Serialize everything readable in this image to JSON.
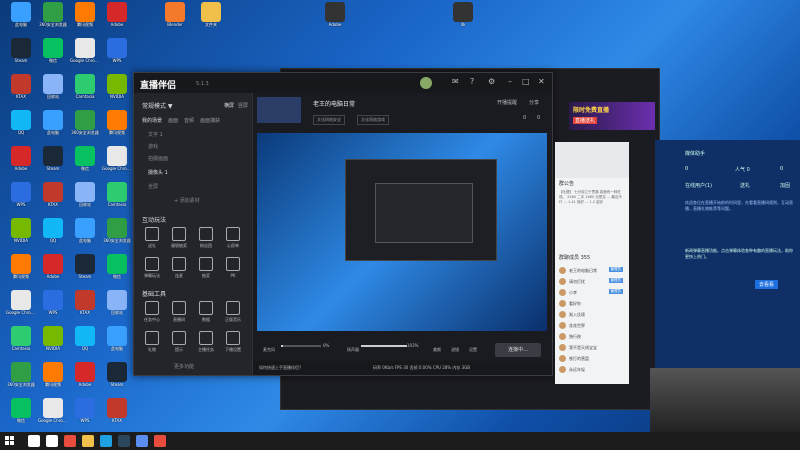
{
  "desktop": {
    "icons": [
      {
        "label": "此电脑",
        "color": "#3aa0ff"
      },
      {
        "label": "360安全浏览器",
        "color": "#2f9e44"
      },
      {
        "label": "腾讯视频",
        "color": "#ff7a00"
      },
      {
        "label": "Adobe",
        "color": "#d62828"
      },
      {
        "label": "Steam",
        "color": "#1b2838"
      },
      {
        "label": "微信",
        "color": "#07c160"
      },
      {
        "label": "Google Chrome",
        "color": "#e8e8e8"
      },
      {
        "label": "WPS",
        "color": "#2b6de0"
      },
      {
        "label": "KTAX",
        "color": "#c0392b"
      },
      {
        "label": "回收站",
        "color": "#8ab4f8"
      },
      {
        "label": "Camtasia",
        "color": "#2ecc71"
      },
      {
        "label": "NVIDIA",
        "color": "#76b900"
      },
      {
        "label": "QQ",
        "color": "#12b7f5"
      }
    ],
    "top_icons": [
      {
        "label": "Blender",
        "color": "#f5792a"
      },
      {
        "label": "文件夹",
        "color": "#f0c04a"
      },
      {
        "label": "Adobe",
        "color": "#333"
      },
      {
        "label": "4k",
        "color": "#333"
      }
    ]
  },
  "app": {
    "logo": "直播伴侣",
    "version": "5.1.3",
    "sidebar": {
      "mode": "常规模式 ▼",
      "landscape": "横屏",
      "portrait": "竖屏",
      "tabs": [
        "我的场景",
        "画面",
        "音频",
        "画面捕获"
      ],
      "scenes": [
        "文字 1",
        "游戏",
        "拍摄画面",
        "摄像头 1",
        "全屏"
      ],
      "add_material": "+ 添加素材",
      "interaction_title": "互动玩法",
      "interaction_tools": [
        "送礼",
        "福袋抽奖",
        "粉丝团",
        "心愿单",
        "弹幕玩法",
        "连麦",
        "抽奖",
        "PK"
      ],
      "basic_title": "基础工具",
      "basic_tools": [
        "任务中心",
        "直播间",
        "数据",
        "正版音乐",
        "礼物",
        "提示",
        "主播任务",
        "下播设置"
      ],
      "more": "更多功能"
    },
    "room": {
      "title": "老王的电脑日常",
      "tags": [
        "文化网络安全",
        "文化网络游戏"
      ],
      "open_live": "开播提醒",
      "share": "分享",
      "likes": "0",
      "viewers": "0",
      "thumb_label": "日常问题聊聊",
      "mic_label": "麦克风",
      "mic_value": "0%",
      "speaker_label": "扬声器",
      "speaker_value": "103%",
      "effects": [
        "美颜",
        "滤镜",
        "设置"
      ],
      "live_button": "连接中...",
      "status_tip": "如何快速上手直播伴侣?",
      "status_stats": "码率 0Kb/s   FPS 30   丢帧 0.00%   CPU 28%   内存 3GB"
    },
    "chat": {
      "notice_title": "群公告",
      "notice_text": "【吐槽】 七分钟之于思路 若面有一种在现。 2580 二手 1680 元是否 ... 最近不行 ... 1.41 就好 ... 1.2 起步",
      "members_title": "群聊成员 355",
      "members": [
        {
          "name": "老王的电脑日常",
          "tag": "管理员"
        },
        {
          "name": "请勿打扰",
          "tag": "管理员"
        },
        {
          "name": "小李",
          "tag": "管理员"
        },
        {
          "name": "看好你",
          "tag": ""
        },
        {
          "name": "渐入佳境",
          "tag": ""
        },
        {
          "name": "花花世界",
          "tag": ""
        },
        {
          "name": "独行侠",
          "tag": ""
        },
        {
          "name": "我不是天线宝宝",
          "tag": ""
        },
        {
          "name": "铁打的营盘",
          "tag": ""
        },
        {
          "name": "永远年轻",
          "tag": ""
        }
      ]
    },
    "ad": {
      "line1": "限时免费直播",
      "line2": "直播送礼"
    }
  },
  "right_panel": {
    "title": "媒体助手",
    "counts": [
      "0",
      "人气 0",
      "0"
    ],
    "row": [
      "在线用户(1)",
      "送礼",
      "加固"
    ],
    "paragraph": "欢迎各位在直播开始前的时间里，先看看直播间规则，互动直播，直播礼物推荐等问题。",
    "highlight": "新闻弹幕直播功能。点击弹幕体验各种有趣的直播玩法，助你更快上热门。",
    "button": "去看看"
  },
  "taskbar": {
    "icons": [
      {
        "name": "search",
        "color": "#fff"
      },
      {
        "name": "task-view",
        "color": "#fff"
      },
      {
        "name": "chrome",
        "color": "#e74c3c"
      },
      {
        "name": "folder",
        "color": "#f0c04a"
      },
      {
        "name": "edge",
        "color": "#1fa0e0"
      },
      {
        "name": "steam",
        "color": "#2a475e"
      },
      {
        "name": "app",
        "color": "#5b8def"
      },
      {
        "name": "live",
        "color": "#e84c3d"
      }
    ]
  }
}
